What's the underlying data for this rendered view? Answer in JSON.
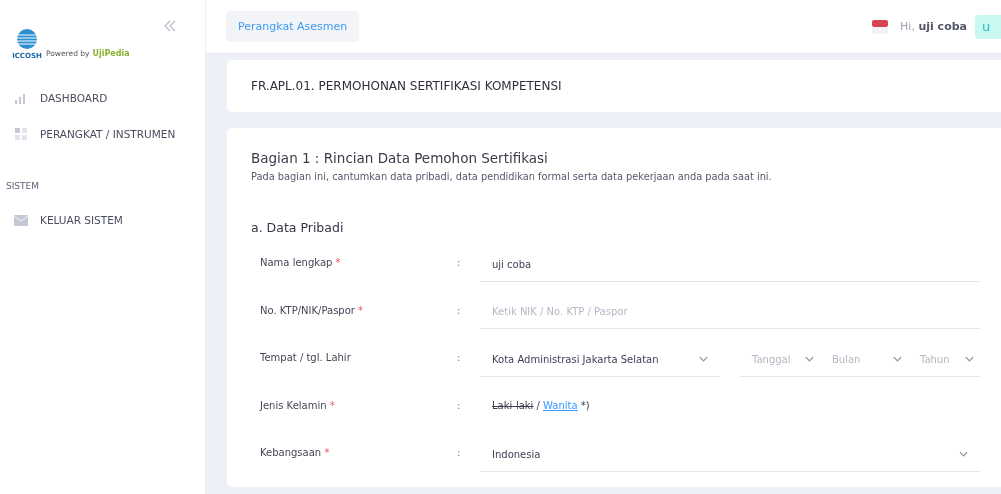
{
  "logo": {
    "name": "ICCOSH",
    "powered_by": "Powered by",
    "partner": "UjiPedia"
  },
  "sidebar": {
    "items": [
      {
        "label": "DASHBOARD"
      },
      {
        "label": "PERANGKAT / INSTRUMEN"
      }
    ],
    "section": "SISTEM",
    "section_items": [
      {
        "label": "KELUAR SISTEM"
      }
    ]
  },
  "topbar": {
    "button": "Perangkat Asesmen",
    "greeting": "Hi,",
    "user": "uji coba",
    "avatar": "u"
  },
  "page_title": "FR.APL.01. PERMOHONAN SERTIFIKASI KOMPETENSI",
  "section": {
    "title": "Bagian 1 : Rincian Data Pemohon Sertifikasi",
    "description": "Pada bagian ini, cantumkan data pribadi, data pendidikan formal serta data pekerjaan anda pada saat ini.",
    "subtitle": "a. Data Pribadi"
  },
  "fields": [
    {
      "kind": "text",
      "label": "Nama lengkap",
      "required_mark": "*",
      "separator": ":",
      "value": "uji coba"
    },
    {
      "kind": "text",
      "label": "No. KTP/NIK/Paspor",
      "required_mark": "*",
      "separator": ":",
      "placeholder": "Ketik NIK / No. KTP / Paspor"
    },
    {
      "kind": "birth",
      "label": "Tempat / tgl. Lahir",
      "separator": ":",
      "value": "Kota Administrasi Jakarta Selatan",
      "date_parts": [
        "Tanggal",
        "Bulan",
        "Tahun"
      ]
    },
    {
      "kind": "gender",
      "label": "Jenis Kelamin",
      "required_mark": "*",
      "separator": ":",
      "options": [
        {
          "label": "Laki-laki",
          "struck": true
        },
        {
          "label": "Wanita",
          "struck": false
        }
      ],
      "divider": "/",
      "note": "*)"
    },
    {
      "kind": "select",
      "label": "Kebangsaan",
      "required_mark": "*",
      "separator": ":",
      "value": "Indonesia"
    }
  ]
}
